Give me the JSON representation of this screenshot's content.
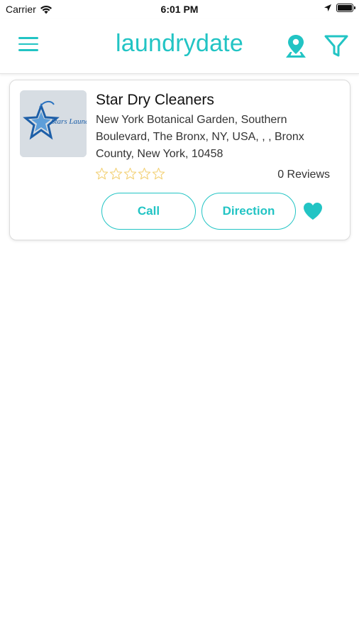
{
  "status_bar": {
    "carrier": "Carrier",
    "time": "6:01 PM"
  },
  "header": {
    "title": "laundrydate",
    "icons": [
      "menu-icon",
      "map-pin-icon",
      "filter-icon"
    ]
  },
  "colors": {
    "accent": "#22c4c4",
    "star_outline": "#f3d27a"
  },
  "listings": [
    {
      "name": "Star Dry Cleaners",
      "address": "New York Botanical Garden, Southern Boulevard, The Bronx, NY, USA, , , Bronx County, New York, 10458",
      "logo_text": "Stars Laundry",
      "rating": 0,
      "rating_max": 5,
      "reviews_label": "0 Reviews",
      "call_label": "Call",
      "direction_label": "Direction",
      "favorite": true
    }
  ]
}
